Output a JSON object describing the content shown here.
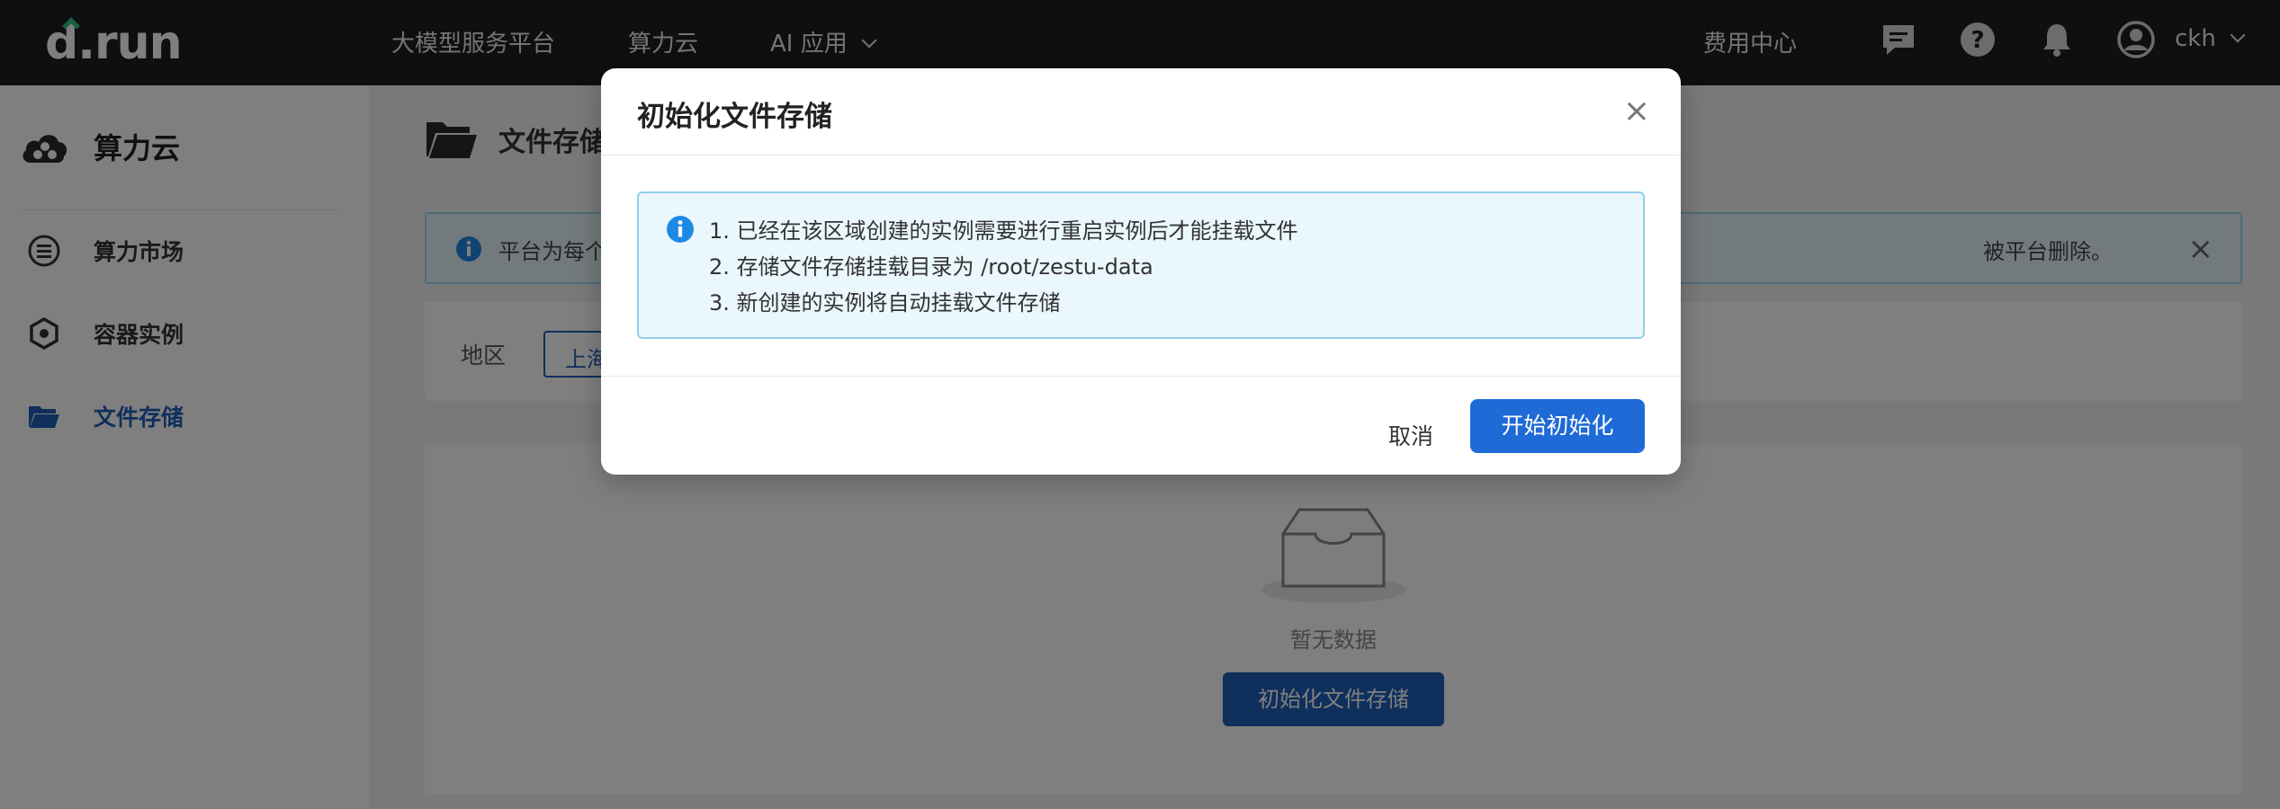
{
  "topbar": {
    "logo": "d.run",
    "nav": [
      "大模型服务平台",
      "算力云",
      "AI 应用"
    ],
    "billing": "费用中心",
    "username": "ckh",
    "icons": [
      "message-icon",
      "help-icon",
      "bell-icon",
      "user-avatar-icon",
      "chevron-down-icon"
    ]
  },
  "sidebar": {
    "title": "算力云",
    "items": [
      {
        "label": "算力市场",
        "icon": "list-icon",
        "active": false
      },
      {
        "label": "容器实例",
        "icon": "hexagon-icon",
        "active": false
      },
      {
        "label": "文件存储",
        "icon": "folder-icon",
        "active": true
      }
    ]
  },
  "main": {
    "title": "文件存储",
    "notice_start": "平台为每个",
    "notice_end": "被平台删除。",
    "filter_label": "地区",
    "region_value": "上海",
    "empty_text": "暂无数据",
    "empty_button": "初始化文件存储"
  },
  "modal": {
    "title": "初始化文件存储",
    "lines": [
      "1. 已经在该区域创建的实例需要进行重启实例后才能挂载文件",
      "2. 存储文件存储挂载目录为 /root/zestu-data",
      "3. 新创建的实例将自动挂载文件存储"
    ],
    "cancel": "取消",
    "confirm": "开始初始化"
  },
  "colors": {
    "primary": "#1e6ad6",
    "topbar": "#1e1f22",
    "info_bg": "#eaf7fd",
    "info_border": "#8fcfec"
  }
}
